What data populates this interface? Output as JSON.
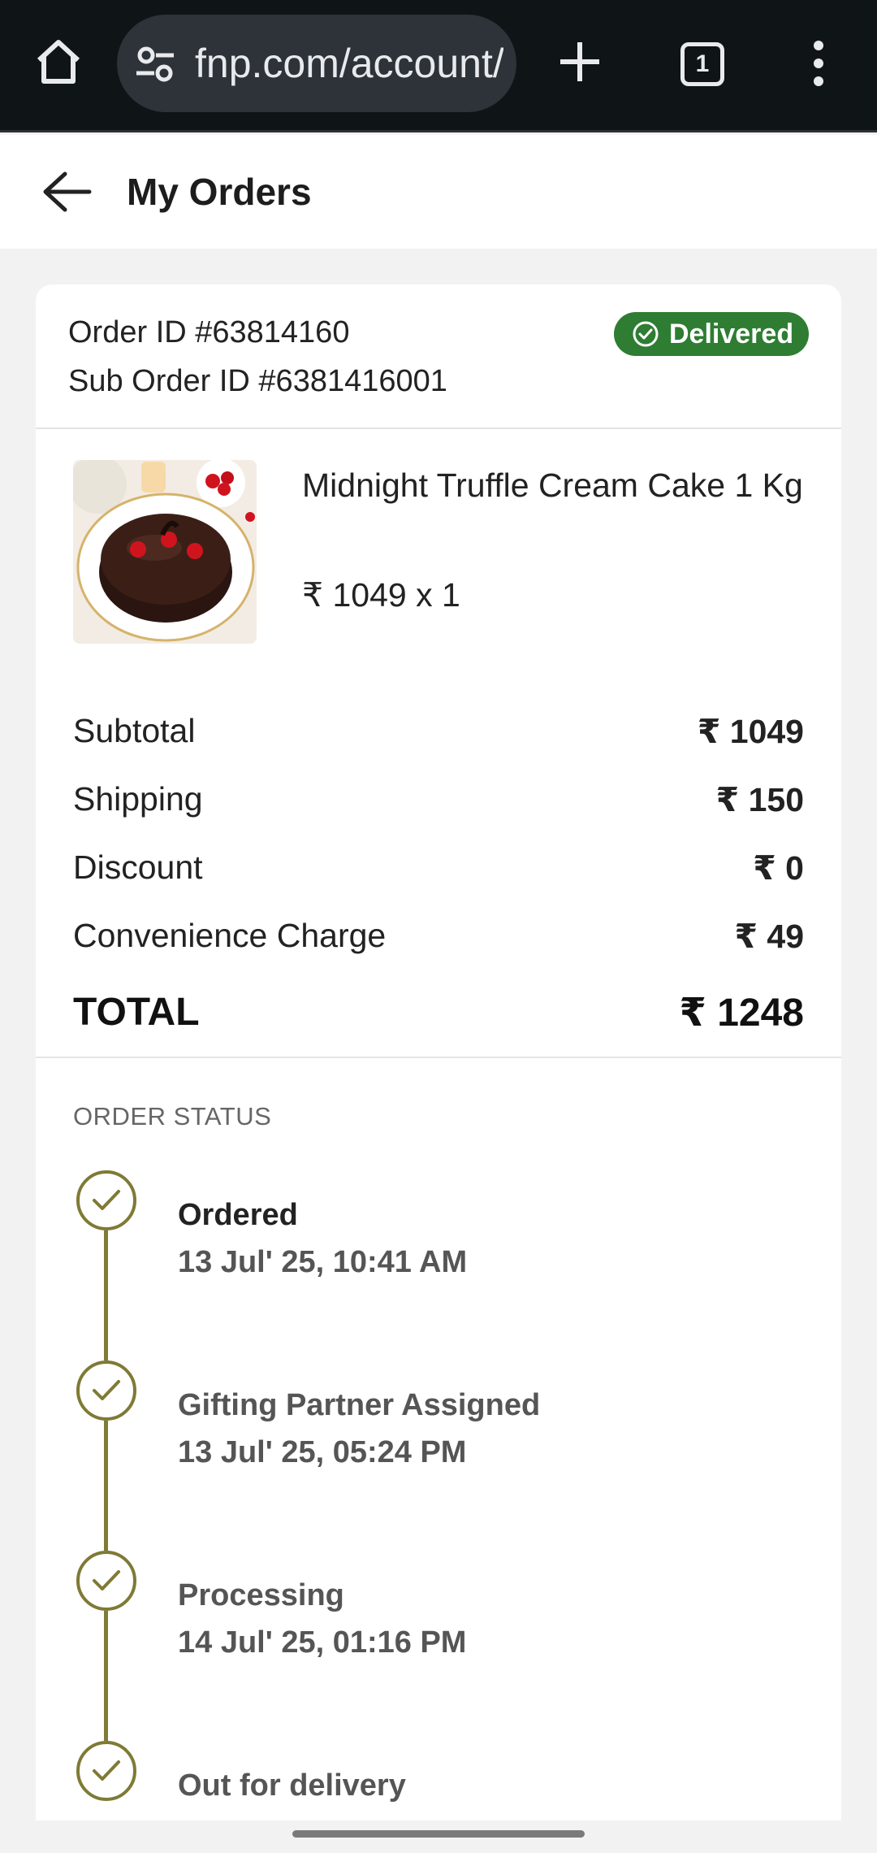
{
  "browser": {
    "url": "fnp.com/account/",
    "tab_count": "1"
  },
  "header": {
    "title": "My Orders"
  },
  "order": {
    "order_id": "Order ID #63814160",
    "sub_order_id": "Sub Order ID #6381416001",
    "status_badge": "Delivered",
    "status_color": "#2e7d32"
  },
  "product": {
    "name": "Midnight Truffle Cream Cake 1 Kg",
    "price": "₹ 1049 x 1"
  },
  "summary": [
    {
      "label": "Subtotal",
      "value": "₹ 1049"
    },
    {
      "label": "Shipping",
      "value": "₹ 150"
    },
    {
      "label": "Discount",
      "value": "₹ 0"
    },
    {
      "label": "Convenience Charge",
      "value": "₹ 49"
    },
    {
      "label": "TOTAL",
      "value": "₹ 1248"
    }
  ],
  "order_status": {
    "title": "ORDER STATUS",
    "accent_color": "#7f7a35",
    "steps": [
      {
        "label": "Ordered",
        "time": "13 Jul' 25, 10:41 AM"
      },
      {
        "label": "Gifting Partner Assigned",
        "time": "13 Jul' 25, 05:24 PM"
      },
      {
        "label": "Processing",
        "time": "14 Jul' 25, 01:16 PM"
      },
      {
        "label": "Out for delivery",
        "time": ""
      }
    ]
  }
}
